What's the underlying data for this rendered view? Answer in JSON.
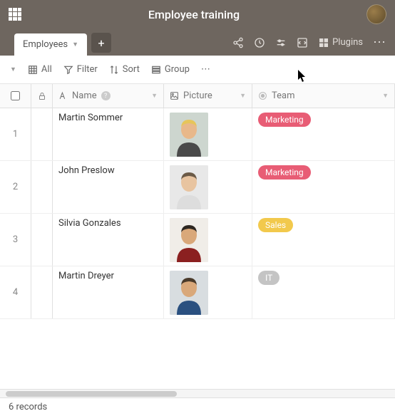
{
  "header": {
    "title": "Employee training"
  },
  "tabs": {
    "active": "Employees",
    "plugins_label": "Plugins"
  },
  "toolbar": {
    "all": "All",
    "filter": "Filter",
    "sort": "Sort",
    "group": "Group"
  },
  "columns": {
    "name": "Name",
    "picture": "Picture",
    "team": "Team"
  },
  "rows": [
    {
      "idx": "1",
      "name": "Martin Sommer",
      "team": "Marketing",
      "team_color": "#e85d75"
    },
    {
      "idx": "2",
      "name": "John Preslow",
      "team": "Marketing",
      "team_color": "#e85d75"
    },
    {
      "idx": "3",
      "name": "Silvia Gonzales",
      "team": "Sales",
      "team_color": "#f2c94c"
    },
    {
      "idx": "4",
      "name": "Martin Dreyer",
      "team": "IT",
      "team_color": "#c4c4c4"
    }
  ],
  "footer": {
    "records": "6 records"
  },
  "pics": {
    "0": {
      "bg": "#cdd6cf",
      "hair": "#e6c55a",
      "shirt": "#4a4a4a",
      "skin": "#e8b88a"
    },
    "1": {
      "bg": "#e8e8e8",
      "hair": "#6b5a47",
      "shirt": "#dddddd",
      "skin": "#e8c4a0"
    },
    "2": {
      "bg": "#f0ede8",
      "hair": "#2d2620",
      "shirt": "#8b2020",
      "skin": "#d9a87a"
    },
    "3": {
      "bg": "#d8dde0",
      "hair": "#4a3a2a",
      "shirt": "#2a5080",
      "skin": "#d9a87a"
    }
  }
}
